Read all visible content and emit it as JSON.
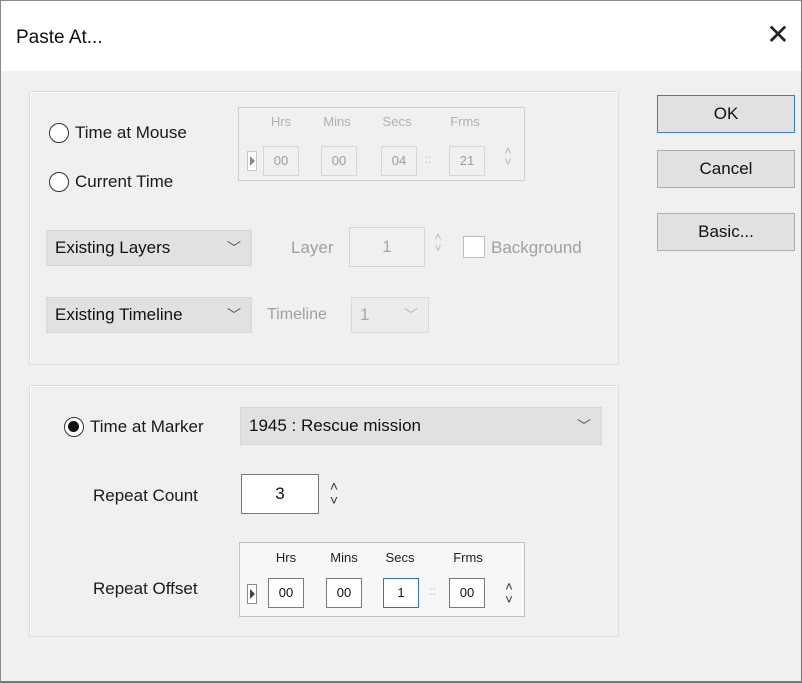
{
  "window": {
    "title": "Paste At...",
    "close_glyph": "✕"
  },
  "position_group": {
    "time_at_mouse_label": "Time at Mouse",
    "current_time_label": "Current Time",
    "timecode": {
      "headers": [
        "Hrs",
        "Mins",
        "Secs",
        "Frms"
      ],
      "hrs": "00",
      "mins": "00",
      "secs": "04",
      "frms": "21"
    },
    "layers_select": "Existing Layers",
    "layer_label": "Layer",
    "layer_value": "1",
    "background_label": "Background",
    "background_checked": false,
    "timeline_select": "Existing Timeline",
    "timeline_label": "Timeline",
    "timeline_value": "1"
  },
  "marker_group": {
    "time_at_marker_label": "Time at Marker",
    "time_at_marker_selected": true,
    "marker_select": "1945 : Rescue mission",
    "repeat_count_label": "Repeat Count",
    "repeat_count_value": "3",
    "repeat_offset_label": "Repeat Offset",
    "offset": {
      "headers": [
        "Hrs",
        "Mins",
        "Secs",
        "Frms"
      ],
      "hrs": "00",
      "mins": "00",
      "secs": "1",
      "frms": "00"
    }
  },
  "buttons": {
    "ok": "OK",
    "cancel": "Cancel",
    "basic": "Basic..."
  },
  "icons": {
    "close": "close-icon",
    "chevron": "chevron-down-icon",
    "spin": "spin-up-down-icon",
    "play": "play-icon"
  },
  "colors": {
    "default_button_border": "#3a7bd5",
    "dialog_bg": "#f0f0f0",
    "focus_border": "#2f72c9"
  }
}
